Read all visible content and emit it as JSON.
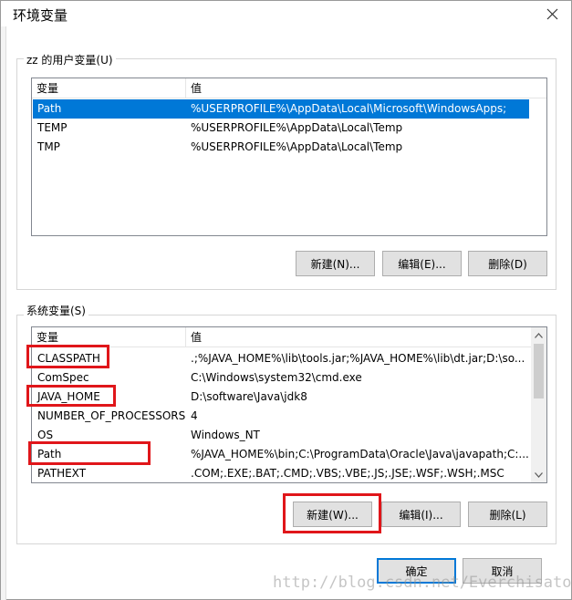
{
  "window": {
    "title": "环境变量",
    "close_icon": "close-icon"
  },
  "user_vars": {
    "group_label": "zz 的用户变量(U)",
    "columns": [
      "变量",
      "值"
    ],
    "rows": [
      {
        "name": "Path",
        "value": "%USERPROFILE%\\AppData\\Local\\Microsoft\\WindowsApps;",
        "selected": true
      },
      {
        "name": "TEMP",
        "value": "%USERPROFILE%\\AppData\\Local\\Temp",
        "selected": false
      },
      {
        "name": "TMP",
        "value": "%USERPROFILE%\\AppData\\Local\\Temp",
        "selected": false
      }
    ],
    "buttons": {
      "new": "新建(N)...",
      "edit": "编辑(E)...",
      "delete": "删除(D)"
    }
  },
  "system_vars": {
    "group_label": "系统变量(S)",
    "columns": [
      "变量",
      "值"
    ],
    "rows": [
      {
        "name": "CLASSPATH",
        "value": ".;%JAVA_HOME%\\lib\\tools.jar;%JAVA_HOME%\\lib\\dt.jar;D:\\so..."
      },
      {
        "name": "ComSpec",
        "value": "C:\\Windows\\system32\\cmd.exe"
      },
      {
        "name": "JAVA_HOME",
        "value": "D:\\software\\Java\\jdk8"
      },
      {
        "name": "NUMBER_OF_PROCESSORS",
        "value": "4"
      },
      {
        "name": "OS",
        "value": "Windows_NT"
      },
      {
        "name": "Path",
        "value": "%JAVA_HOME%\\bin;C:\\ProgramData\\Oracle\\Java\\javapath;C:..."
      },
      {
        "name": "PATHEXT",
        "value": ".COM;.EXE;.BAT;.CMD;.VBS;.VBE;.JS;.JSE;.WSF;.WSH;.MSC"
      }
    ],
    "buttons": {
      "new": "新建(W)...",
      "edit": "编辑(I)...",
      "delete": "删除(L)"
    }
  },
  "dialog_buttons": {
    "ok": "确定",
    "cancel": "取消"
  },
  "watermark": "http://blog.csdn.net/Everchisato",
  "colors": {
    "selection": "#0078d7",
    "highlight_box": "#e0161a",
    "focus_border": "#0078d7"
  }
}
